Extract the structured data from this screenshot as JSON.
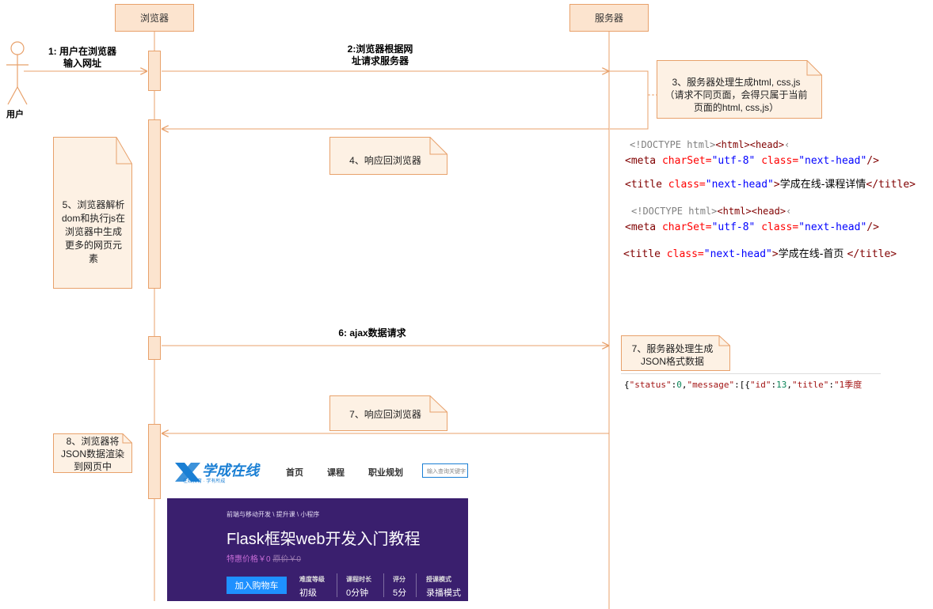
{
  "lifelines": {
    "browser": "浏览器",
    "server": "服务器",
    "actor": "用户"
  },
  "messages": {
    "m1": [
      "1: 用户在浏览器",
      "输入网址"
    ],
    "m2": [
      "2:浏览器根据网",
      "址请求服务器"
    ],
    "m6": "6: ajax数据请求"
  },
  "notes": {
    "n3": [
      "3、服务器处理生成html, css,js",
      "（请求不同页面，会得只属于当前",
      "页面的html, css,js）"
    ],
    "n4": "4、响应回浏览器",
    "n5": [
      "5、浏览器解析",
      "dom和执行js在",
      "浏览器中生成",
      "更多的网页元",
      "素"
    ],
    "n7a": [
      "7、服务器处理生成",
      "JSON格式数据"
    ],
    "n7b": "7、响应回浏览器",
    "n8": [
      "8、浏览器将",
      "JSON数据渲染",
      "到网页中"
    ]
  },
  "code": {
    "doctype": "<!DOCTYPE html>",
    "html_tag": "<html>",
    "head_tag": "<head>",
    "ellipsis": "‹",
    "meta_open": "<meta ",
    "charset_attr": "charSet=",
    "charset_val": "\"utf-8\"",
    "class_attr": " class=",
    "class_val": "\"next-head\"",
    "meta_close": "/>",
    "title_open": "<title ",
    "title_close_bracket": ">",
    "title_end": "</title>",
    "title1": "学成在线-课程详情",
    "title2": "学成在线-首页 "
  },
  "json_text": {
    "open": "{",
    "k_status": "\"status\"",
    "colon1": ":",
    "v_status": "0",
    "comma1": ",",
    "k_message": "\"message\"",
    "colon2": ":[{",
    "k_id": "\"id\"",
    "colon3": ":",
    "v_id": "13",
    "comma2": ",",
    "k_title": "\"title\"",
    "colon4": ":",
    "v_title": "\"1季度"
  },
  "site": {
    "logo": "学成在线",
    "logo_sub": "在线教育 · 学有所成",
    "nav": [
      "首页",
      "课程",
      "职业规划"
    ],
    "search_placeholder": "输入查询关键字",
    "breadcrumb": "前端与移动开发 \\ 提升课 \\ 小程序",
    "course_title": "Flask框架web开发入门教程",
    "price": "特惠价格￥0",
    "orig_price": "原价￥0",
    "cart_button": "加入购物车",
    "stats": [
      {
        "label": "难度等级",
        "value": "初级"
      },
      {
        "label": "课程时长",
        "value": "0分钟"
      },
      {
        "label": "评分",
        "value": "5分"
      },
      {
        "label": "授课模式",
        "value": "录播模式"
      }
    ]
  },
  "colors": {
    "box_fill": "#fce4cf",
    "box_border": "#e8a16b",
    "note_fill": "#fdf1e4",
    "banner": "#3a1f6e",
    "logo_blue": "#1a7fd4",
    "cart_blue": "#1e90ff",
    "price_purple": "#c56bd6"
  }
}
